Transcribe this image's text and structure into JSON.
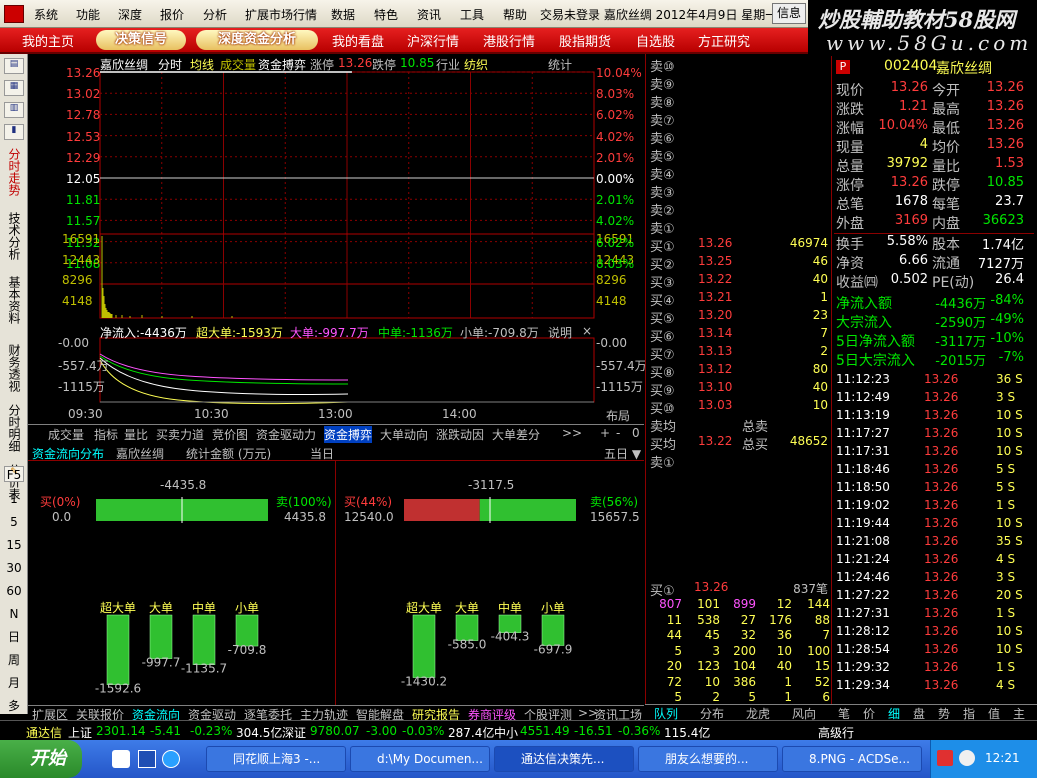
{
  "menu": {
    "items": [
      "系统",
      "功能",
      "深度",
      "报价",
      "分析",
      "扩展市场行情",
      "数据",
      "特色",
      "资讯",
      "工具",
      "帮助"
    ],
    "status": "交易未登录  嘉欣丝绸  2012年4月9日  星期一",
    "info_button": "信息"
  },
  "watermark": {
    "line1": "炒股輔助教材58股网",
    "line2": "www.58Gu.com"
  },
  "nav": {
    "items": [
      "我的主页",
      "决策信号",
      "深度资金分析",
      "我的看盘",
      "沪深行情",
      "港股行情",
      "股指期货",
      "自选股",
      "方正研究"
    ]
  },
  "leftbar": {
    "vertical_tabs": [
      "分时走势",
      "技术分析",
      "基本资料",
      "财务透视",
      "分时明细",
      "分价表"
    ],
    "periods": [
      "F5",
      "1",
      "5",
      "15",
      "30",
      "60",
      "N",
      "日",
      "周",
      "月",
      "多"
    ]
  },
  "chart": {
    "header": {
      "name": "嘉欣丝绸",
      "items": [
        "分时",
        "均线",
        "成交量",
        "资金搏弈"
      ],
      "zt_label": "涨停",
      "zt": "13.26",
      "dt_label": "跌停",
      "dt": "10.85",
      "industry_label": "行业",
      "industry": "纺织",
      "stat": "统计"
    },
    "price_ticks": [
      "13.26",
      "13.02",
      "12.78",
      "12.53",
      "12.29",
      "12.05",
      "11.81",
      "11.57",
      "11.32",
      "11.08"
    ],
    "pct_ticks": [
      "10.04%",
      "8.03%",
      "6.02%",
      "4.02%",
      "2.01%",
      "0.00%",
      "2.01%",
      "4.02%",
      "6.02%",
      "8.03%"
    ],
    "vol_ticks": [
      "16591",
      "12443",
      "8296",
      "4148"
    ],
    "flow_header": {
      "net": "净流入:-4436万",
      "super": "超大单:-1593万",
      "big": "大单:-997.7万",
      "mid": "中单:-1136万",
      "small": "小单:-709.8万",
      "explain": "说明",
      "close": "×"
    },
    "flow_ticks": [
      "-0.00",
      "-557.4万",
      "-1115万"
    ],
    "time_ticks": [
      "09:30",
      "10:30",
      "13:00",
      "14:00"
    ],
    "layout_btn": "布局"
  },
  "chart_data": {
    "type": "line",
    "title": "嘉欣丝绸 分时",
    "x": [
      "09:30",
      "10:30",
      "13:00",
      "14:00"
    ],
    "series": [
      {
        "name": "价格",
        "values": [
          13.26,
          13.26,
          13.26,
          13.26
        ]
      }
    ],
    "ylim": [
      11.08,
      13.26
    ],
    "xlabel": "",
    "ylabel": ""
  },
  "bottom_tabs": [
    "成交量",
    "指标",
    "量比",
    "买卖力道",
    "竞价图",
    "资金驱动力",
    "资金搏弈",
    "大单动向",
    "涨跌动因",
    "大单差分",
    ">>"
  ],
  "bottom_tabs_right": [
    "+",
    "-",
    "0"
  ],
  "fund": {
    "title": "资金流向分布",
    "stock": "嘉欣丝绸",
    "unit": "统计金额 (万元)",
    "today": "当日",
    "five": "五日 ▼",
    "left": {
      "net": "-4435.8",
      "buy_pct": "买(0%)",
      "buy": "0.0",
      "sell_pct": "卖(100%)",
      "sell": "4435.8"
    },
    "right": {
      "net": "-3117.5",
      "buy_pct": "买(44%)",
      "buy": "12540.0",
      "sell_pct": "卖(56%)",
      "sell": "15657.5"
    },
    "cats": [
      "超大单",
      "大单",
      "中单",
      "小单"
    ],
    "left_vals": [
      "-1592.6",
      "-997.7",
      "-1135.7",
      "-709.8"
    ],
    "right_vals": [
      "-1430.2",
      "-585.0",
      "-404.3",
      "-697.9"
    ]
  },
  "fund_chart_data": {
    "type": "bar",
    "categories": [
      "超大单",
      "大单",
      "中单",
      "小单"
    ],
    "series": [
      {
        "name": "当日",
        "values": [
          -1592.6,
          -997.7,
          -1135.7,
          -709.8
        ]
      },
      {
        "name": "五日",
        "values": [
          -1430.2,
          -585.0,
          -404.3,
          -697.9
        ]
      }
    ]
  },
  "bottom_bar": [
    "扩展区",
    "关联报价",
    "资金流向",
    "资金驱动",
    "逐笔委托",
    "主力轨迹",
    "智能解盘",
    "研究报告",
    "券商评级",
    "个股评测",
    ">>",
    "资讯工场"
  ],
  "orderbook": {
    "sells": [
      "卖⑩",
      "卖⑨",
      "卖⑧",
      "卖⑦",
      "卖⑥",
      "卖⑤",
      "卖④",
      "卖③",
      "卖②",
      "卖①"
    ],
    "buys": [
      {
        "l": "买①",
        "p": "13.26",
        "v": "46974"
      },
      {
        "l": "买②",
        "p": "13.25",
        "v": "46"
      },
      {
        "l": "买③",
        "p": "13.22",
        "v": "40"
      },
      {
        "l": "买④",
        "p": "13.21",
        "v": "1"
      },
      {
        "l": "买⑤",
        "p": "13.20",
        "v": "23"
      },
      {
        "l": "买⑥",
        "p": "13.14",
        "v": "7"
      },
      {
        "l": "买⑦",
        "p": "13.13",
        "v": "2"
      },
      {
        "l": "买⑧",
        "p": "13.12",
        "v": "80"
      },
      {
        "l": "买⑨",
        "p": "13.10",
        "v": "40"
      },
      {
        "l": "买⑩",
        "p": "13.03",
        "v": "10"
      }
    ],
    "sell_avg": "卖均",
    "sell_total": "总卖",
    "buy_avg": "买均",
    "buy_avg_val": "13.22",
    "buy_total": "总买",
    "buy_total_val": "48652",
    "sell1": "卖①",
    "buy1_queue_label": "买①",
    "buy1_queue_price": "13.26",
    "buy1_queue_count": "837笔",
    "queue": [
      [
        "807",
        "101",
        "899",
        "12",
        "144"
      ],
      [
        "11",
        "538",
        "27",
        "176",
        "88"
      ],
      [
        "44",
        "45",
        "32",
        "36",
        "7"
      ],
      [
        "5",
        "3",
        "200",
        "10",
        "100"
      ],
      [
        "20",
        "123",
        "104",
        "40",
        "15"
      ],
      [
        "72",
        "10",
        "386",
        "1",
        "52"
      ],
      [
        "5",
        "2",
        "5",
        "1",
        "6"
      ]
    ],
    "tabs": [
      "队列",
      "分布",
      "龙虎",
      "风向"
    ]
  },
  "quote": {
    "code": "002404",
    "name": "嘉欣丝绸",
    "flag": "P",
    "rows": [
      [
        "现价",
        "13.26",
        "今开",
        "13.26"
      ],
      [
        "涨跌",
        "1.21",
        "最高",
        "13.26"
      ],
      [
        "涨幅",
        "10.04%",
        "最低",
        "13.26"
      ],
      [
        "现量",
        "4",
        "均价",
        "13.26"
      ],
      [
        "总量",
        "39792",
        "量比",
        "1.53"
      ],
      [
        "涨停",
        "13.26",
        "跌停",
        "10.85"
      ],
      [
        "总笔",
        "1678",
        "每笔",
        "23.7"
      ],
      [
        "外盘",
        "3169",
        "内盘",
        "36623"
      ]
    ],
    "rows2": [
      [
        "换手",
        "5.58%",
        "股本",
        "1.74亿"
      ],
      [
        "净资",
        "6.66",
        "流通",
        "7127万"
      ],
      [
        "收益㈣",
        "0.502",
        "PE(动)",
        "26.4"
      ]
    ],
    "flows": [
      [
        "净流入额",
        "-4436万",
        "-84%"
      ],
      [
        "大宗流入",
        "-2590万",
        "-49%"
      ],
      [
        "5日净流入额",
        "-3117万",
        "-10%"
      ],
      [
        "5日大宗流入",
        "-2015万",
        "-7%"
      ]
    ],
    "ticks": [
      [
        "11:12:23",
        "13.26",
        "36 S"
      ],
      [
        "11:12:49",
        "13.26",
        "3 S"
      ],
      [
        "11:13:19",
        "13.26",
        "10 S"
      ],
      [
        "11:17:27",
        "13.26",
        "10 S"
      ],
      [
        "11:17:31",
        "13.26",
        "10 S"
      ],
      [
        "11:18:46",
        "13.26",
        "5 S"
      ],
      [
        "11:18:50",
        "13.26",
        "5 S"
      ],
      [
        "11:19:02",
        "13.26",
        "1 S"
      ],
      [
        "11:19:44",
        "13.26",
        "10 S"
      ],
      [
        "11:21:08",
        "13.26",
        "35 S"
      ],
      [
        "11:21:24",
        "13.26",
        "4 S"
      ],
      [
        "11:24:46",
        "13.26",
        "3 S"
      ],
      [
        "11:27:22",
        "13.26",
        "20 S"
      ],
      [
        "11:27:31",
        "13.26",
        "1 S"
      ],
      [
        "11:28:12",
        "13.26",
        "10 S"
      ],
      [
        "11:28:54",
        "13.26",
        "10 S"
      ],
      [
        "11:29:32",
        "13.26",
        "1 S"
      ],
      [
        "11:29:34",
        "13.26",
        "4 S"
      ]
    ],
    "tabs": [
      "笔",
      "价",
      "细",
      "盘",
      "势",
      "指",
      "值",
      "主"
    ]
  },
  "status": {
    "brand": "通达信",
    "sh_label": "上证",
    "sh": "2301.14",
    "sh_chg": "-5.41",
    "sh_pct": "-0.23%",
    "sh_amt": "304.5亿",
    "sz_label": "深证",
    "sz": "9780.07",
    "sz_chg": "-3.00",
    "sz_pct": "-0.03%",
    "sz_amt": "287.4亿",
    "zx_label": "中小",
    "zx": "4551.49",
    "zx_chg": "-16.51",
    "zx_pct": "-0.36%",
    "zx_amt": "115.4亿",
    "right": "高级行"
  },
  "taskbar": {
    "start": "开始",
    "apps": [
      "同花顺上海3 -...",
      "d:\\My Documen...",
      "通达信决策先...",
      "朋友么想要的...",
      "8.PNG - ACDSe..."
    ],
    "clock": "12:21"
  }
}
